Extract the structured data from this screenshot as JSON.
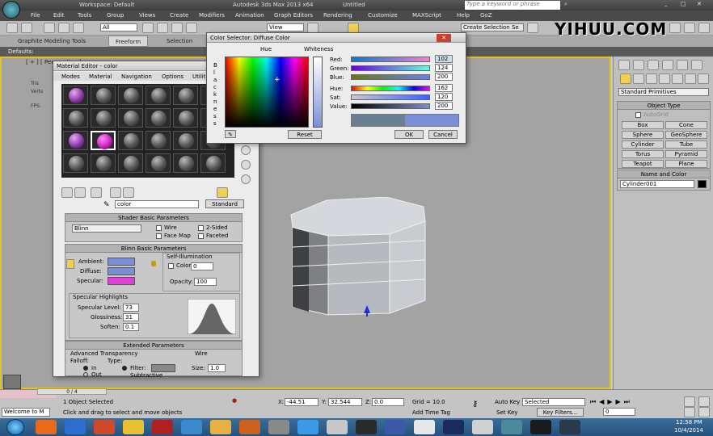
{
  "app": {
    "title": "Autodesk 3ds Max 2013 x64",
    "doc": "Untitled",
    "workspace": "Workspace: Default",
    "search_placeholder": "Type a keyword or phrase"
  },
  "menu": [
    "File",
    "Edit",
    "Tools",
    "Group",
    "Views",
    "Create",
    "Modifiers",
    "Animation",
    "Graph Editors",
    "Rendering",
    "Customize",
    "MAXScript",
    "Help",
    "GoZ"
  ],
  "toolbar": {
    "filter": "All",
    "view": "View",
    "selection_set": "Create Selection Se"
  },
  "ribbon": [
    "Graphite Modeling Tools",
    "Freeform",
    "Selection"
  ],
  "defaults_label": "Defaults:",
  "viewport": {
    "label": "[ + ] [ Perspective ]",
    "stats": [
      "Tris",
      "Verts",
      "FPS:"
    ]
  },
  "watermark": "YIHUU.COM",
  "command_panel": {
    "dropdown": "Standard Primitives",
    "object_type": "Object Type",
    "autogrid": "AutoGrid",
    "buttons": [
      "Box",
      "Cone",
      "Sphere",
      "GeoSphere",
      "Cylinder",
      "Tube",
      "Torus",
      "Pyramid",
      "Teapot",
      "Plane"
    ],
    "name_color": "Name and Color",
    "name_value": "Cylinder001"
  },
  "material_editor": {
    "title": "Material Editor - color",
    "menu": [
      "Modes",
      "Material",
      "Navigation",
      "Options",
      "Utilities"
    ],
    "mat_name": "color",
    "mat_type": "Standard",
    "shader_title": "Shader Basic Parameters",
    "shader": "Blinn",
    "wire": "Wire",
    "two_sided": "2-Sided",
    "face_map": "Face Map",
    "faceted": "Faceted",
    "blinn_title": "Blinn Basic Parameters",
    "ambient": "Ambient:",
    "diffuse": "Diffuse:",
    "specular": "Specular:",
    "self_illum": "Self-Illumination",
    "color_lbl": "Color",
    "color_val": "0",
    "opacity": "Opacity:",
    "opacity_val": "100",
    "spec_title": "Specular Highlights",
    "spec_level": "Specular Level:",
    "spec_level_val": "73",
    "gloss": "Glossiness:",
    "gloss_val": "31",
    "soften": "Soften:",
    "soften_val": "0.1",
    "ext_title": "Extended Parameters",
    "adv_trans": "Advanced Transparency",
    "falloff": "Falloff:",
    "type": "Type:",
    "in": "In",
    "out": "Out",
    "filter": "Filter:",
    "subtractive": "Subtractive",
    "wire2": "Wire",
    "size": "Size:",
    "size_val": "1.0",
    "ambient_color": "#7b8fd8",
    "diffuse_color": "#7b8fd8",
    "specular_color": "#e040d8"
  },
  "color_selector": {
    "title": "Color Selector: Diffuse Color",
    "hue_lbl": "Hue",
    "whiteness_lbl": "Whiteness",
    "blackness_lbl": "B l a c k n e s s",
    "reset": "Reset",
    "ok": "OK",
    "cancel": "Cancel",
    "channels": [
      {
        "label": "Red:",
        "value": "102"
      },
      {
        "label": "Green:",
        "value": "124"
      },
      {
        "label": "Blue:",
        "value": "200"
      },
      {
        "label": "Hue:",
        "value": "162"
      },
      {
        "label": "Sat:",
        "value": "120"
      },
      {
        "label": "Value:",
        "value": "200"
      }
    ],
    "swatch_color": "#7b8fd8"
  },
  "status": {
    "selected": "1 Object Selected",
    "prompt": "Click and drag to select and move objects",
    "x_lbl": "X:",
    "x": "-44.51",
    "y_lbl": "Y:",
    "y": "32.544",
    "z_lbl": "Z:",
    "z": "0.0",
    "grid": "Grid = 10.0",
    "add_time_tag": "Add Time Tag",
    "auto_key": "Auto Key",
    "selected_dd": "Selected",
    "set_key": "Set Key",
    "key_filters": "Key Filters...",
    "frame": "0",
    "timeline": "0 / 4",
    "welcome": "Welcome to M"
  },
  "clock": {
    "time": "12:58 PM",
    "date": "10/4/2014"
  }
}
